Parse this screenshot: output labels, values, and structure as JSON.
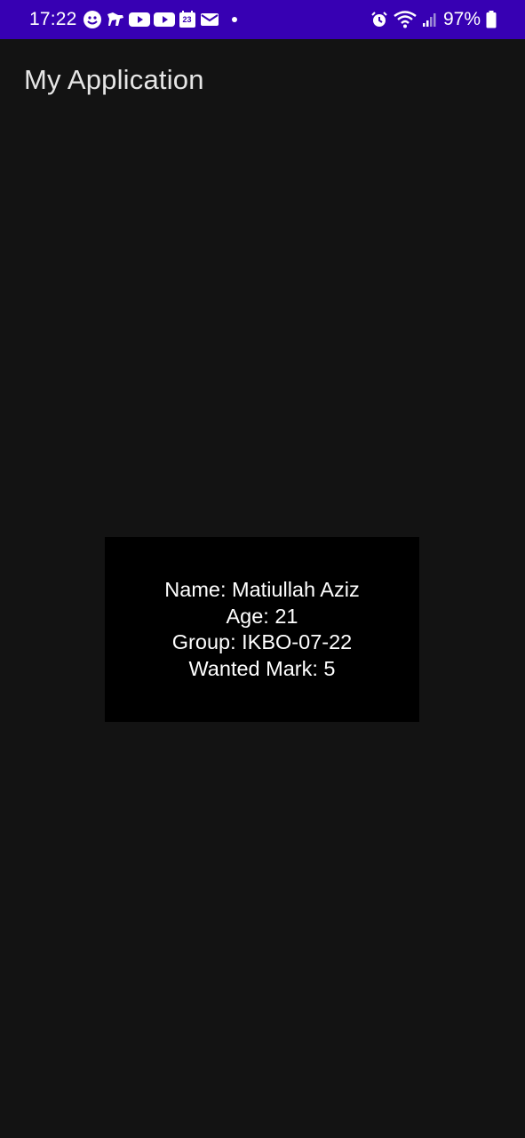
{
  "status_bar": {
    "time": "17:22",
    "battery": "97%",
    "background_color": "#3700b3",
    "left_icons": [
      "smiley-icon",
      "animal-app-icon",
      "youtube-icon",
      "youtube-icon",
      "calendar-icon",
      "mail-icon",
      "more-dot-icon"
    ],
    "calendar_day": "23",
    "right_icons": [
      "alarm-icon",
      "wifi-icon",
      "signal-icon",
      "battery-icon"
    ]
  },
  "app_bar": {
    "title": "My Application"
  },
  "info_card": {
    "name_line": "Name: Matiullah Aziz",
    "age_line": "Age: 21",
    "group_line": "Group: IKBO-07-22",
    "mark_line": "Wanted Mark: 5",
    "background_color": "#000000"
  },
  "theme": {
    "background": "#131313",
    "title_color": "#e6e6e6"
  }
}
